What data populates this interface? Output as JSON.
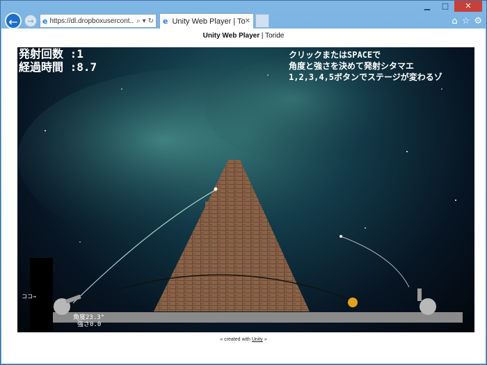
{
  "browser": {
    "url": "https://dl.dropboxusercont...",
    "tab_title": "Unity Web Player | Toride",
    "window_controls": [
      "minimize",
      "maximize",
      "close"
    ]
  },
  "page": {
    "title_bold": "Unity Web Player",
    "title_sep": " | ",
    "title_rest": "Toride",
    "footer_prefix": "« created with ",
    "footer_link": "Unity",
    "footer_suffix": " »"
  },
  "game": {
    "shots_label": "発射回数 :1",
    "time_label": "経過時間 :8.7",
    "instruction_1": "クリックまたはSPACEで",
    "instruction_2": "角度と強さを決めて発射シタマエ",
    "instruction_3": "1,2,3,4,5ボタンでステージが変わるゾ",
    "here_label": "ココ→",
    "angle_label": "角度23.3°",
    "power_label": "強さ0.0"
  }
}
